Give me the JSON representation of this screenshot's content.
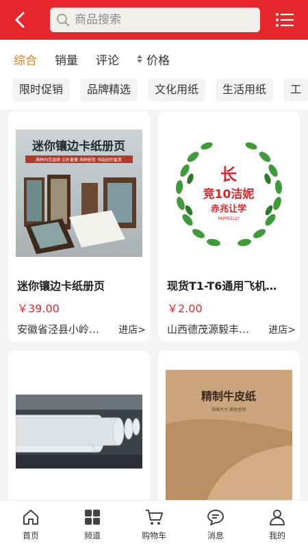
{
  "header": {
    "search_placeholder": "商品搜索",
    "bg_color": "#e5262b"
  },
  "sort": {
    "items": [
      {
        "label": "综合",
        "active": true
      },
      {
        "label": "销量",
        "active": false
      },
      {
        "label": "评论",
        "active": false
      },
      {
        "label": "价格",
        "active": false
      }
    ],
    "active_color": "#f07a14"
  },
  "tags": [
    "限时促销",
    "品牌精选",
    "文化用纸",
    "生活用纸",
    "工"
  ],
  "products": [
    {
      "title": "迷你镶边卡纸册页",
      "price": "￥39.00",
      "shop": "安徽省泾县小岭…",
      "enter": "进店>",
      "image": {
        "headline": "迷你镶边卡纸册页",
        "sub": "两种内页选择  古朴素雅  两种纸性  书画创作鉴赏"
      }
    },
    {
      "title": "现货T1-T6通用飞机…",
      "price": "￥2.00",
      "shop": "山西德茂源毅丰…",
      "enter": "进店>",
      "image": {
        "logo_line1": "竞10洁妮",
        "logo_line2": "赤兆让学",
        "logo_line3": "PAPPEELLY"
      }
    },
    {
      "title": "",
      "price": "",
      "shop": "",
      "enter": "",
      "image": {}
    },
    {
      "title": "",
      "price": "",
      "shop": "",
      "enter": "",
      "image": {
        "headline": "精制牛皮纸",
        "sub": "规格尺寸  质地坚韧"
      }
    }
  ],
  "bottom_nav": [
    {
      "label": "首页",
      "icon": "home-icon"
    },
    {
      "label": "频道",
      "icon": "grid-icon"
    },
    {
      "label": "购物车",
      "icon": "cart-icon"
    },
    {
      "label": "消息",
      "icon": "message-icon"
    },
    {
      "label": "我的",
      "icon": "user-icon"
    }
  ]
}
